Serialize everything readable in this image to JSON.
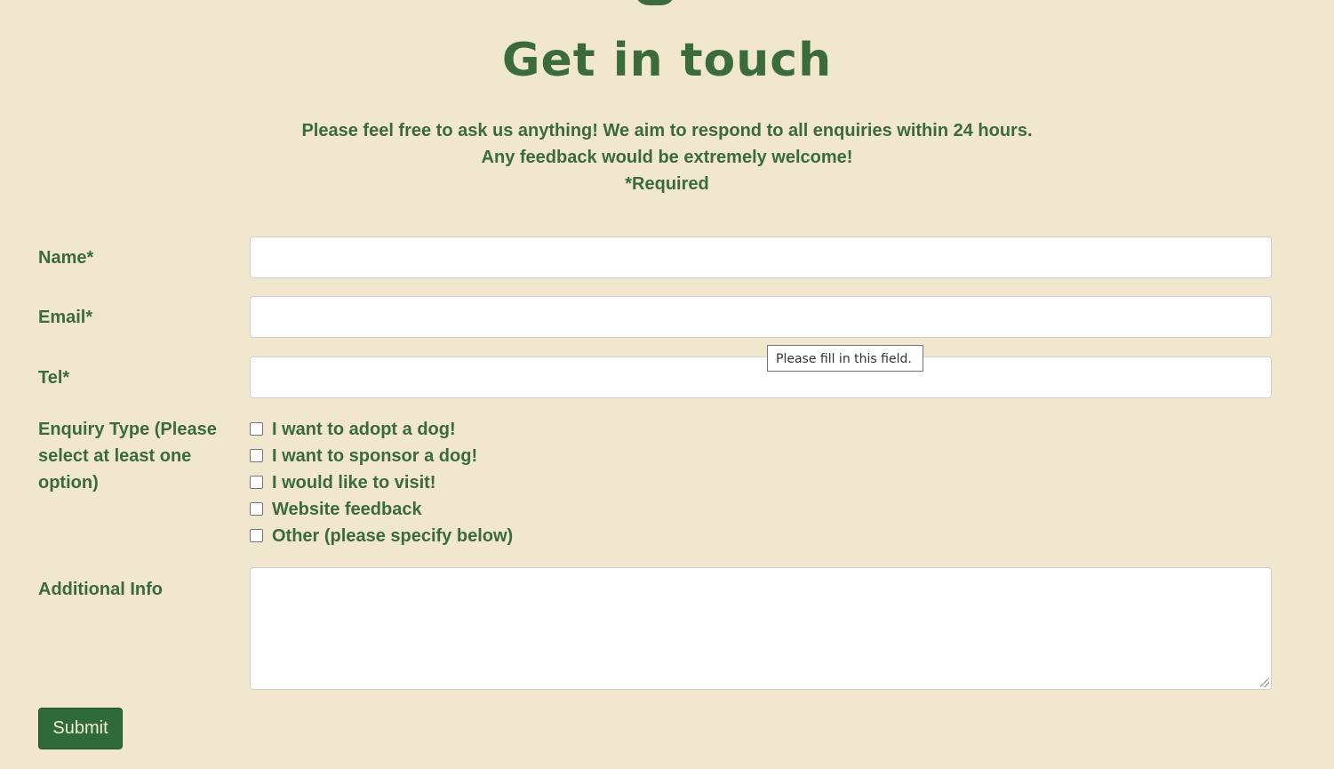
{
  "header": {
    "title": "Get in touch"
  },
  "intro": {
    "line1": "Please feel free to ask us anything! We aim to respond to all enquiries within 24 hours.",
    "line2": "Any feedback would be extremely welcome!",
    "line3": "*Required"
  },
  "form": {
    "name_label": "Name*",
    "name_value": "",
    "email_label": "Email*",
    "email_value": "",
    "tel_label": "Tel*",
    "tel_value": "",
    "enquiry_label": "Enquiry Type (Please select at least one option)",
    "enquiry_options": [
      {
        "label": "I want to adopt a dog!",
        "checked": false
      },
      {
        "label": "I want to sponsor a dog!",
        "checked": false
      },
      {
        "label": "I would like to visit!",
        "checked": false
      },
      {
        "label": "Website feedback",
        "checked": false
      },
      {
        "label": "Other (please specify below)",
        "checked": false
      }
    ],
    "additional_label": "Additional Info",
    "additional_value": "",
    "submit_label": "Submit"
  },
  "tooltip": {
    "text": "Please fill in this field."
  },
  "colors": {
    "background": "#f1e7cf",
    "accent": "#3b6a3d",
    "button": "#2f6a3a"
  }
}
